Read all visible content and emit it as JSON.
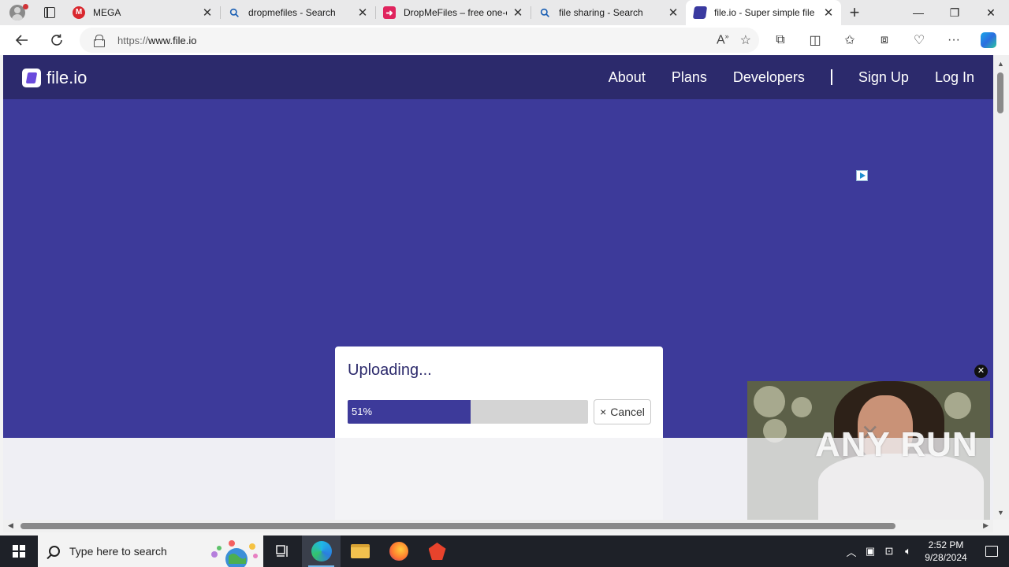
{
  "browser": {
    "tabs": [
      {
        "title": "MEGA",
        "favicon": "mega-icon",
        "active": false
      },
      {
        "title": "dropmefiles - Search",
        "favicon": "search-icon",
        "active": false
      },
      {
        "title": "DropMeFiles – free one-c",
        "favicon": "dropmefiles-icon",
        "active": false
      },
      {
        "title": "file sharing - Search",
        "favicon": "search-icon",
        "active": false
      },
      {
        "title": "file.io - Super simple file",
        "favicon": "fileio-icon",
        "active": true
      }
    ],
    "url_protocol": "https://",
    "url_host": "www.file.io"
  },
  "site": {
    "logo_text": "file.io",
    "nav": [
      "About",
      "Plans",
      "Developers",
      "Sign Up",
      "Log In"
    ],
    "brand_color": "#3d3a9a",
    "header_color": "#2c2a6c"
  },
  "upload": {
    "heading": "Uploading...",
    "progress_percent": 51,
    "progress_label": "51%",
    "cancel_label": "Cancel",
    "cancel_icon": "×"
  },
  "watermark": "ANY RUN",
  "taskbar": {
    "search_placeholder": "Type here to search",
    "time": "2:52 PM",
    "date": "9/28/2024"
  }
}
